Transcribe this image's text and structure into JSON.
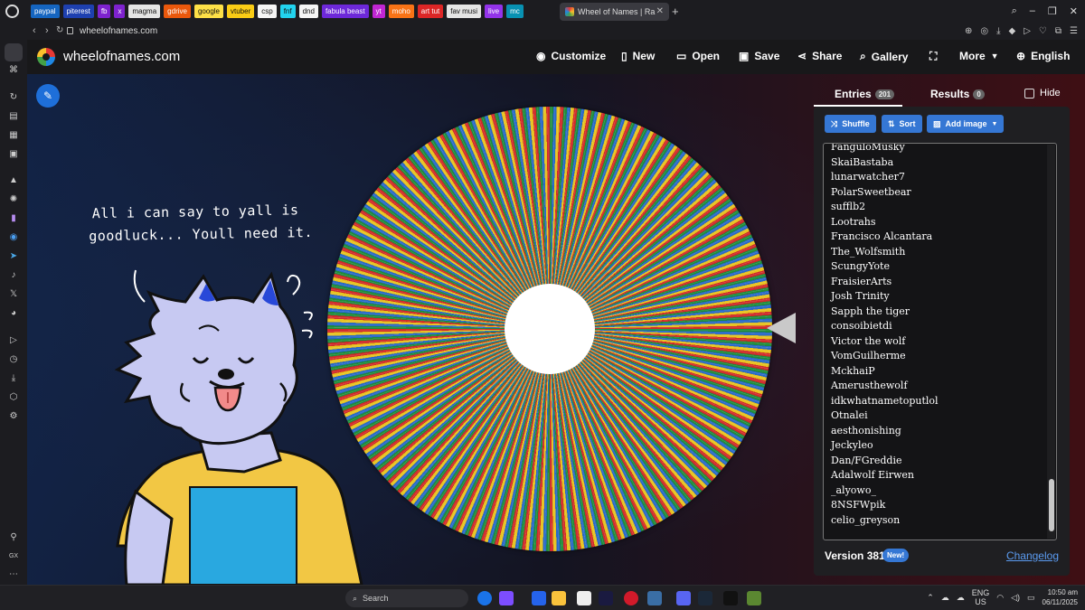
{
  "browser": {
    "bookmarks": [
      {
        "label": "paypal",
        "color": "#1565c0"
      },
      {
        "label": "piterest",
        "color": "#1e40af"
      },
      {
        "label": "fb",
        "color": "#7e22ce"
      },
      {
        "label": "x",
        "color": "#7e22ce"
      },
      {
        "label": "magma",
        "color": "#e5e5e5"
      },
      {
        "label": "gdrive",
        "color": "#ea580c"
      },
      {
        "label": "google",
        "color": "#fde047"
      },
      {
        "label": "vtuber",
        "color": "#facc15"
      },
      {
        "label": "csp",
        "color": "#f5f5f5"
      },
      {
        "label": "fnf",
        "color": "#22d3ee"
      },
      {
        "label": "dnd",
        "color": "#f5f5f5"
      },
      {
        "label": "fabula beast",
        "color": "#6d28d9"
      },
      {
        "label": "yt",
        "color": "#c026d3"
      },
      {
        "label": "moho",
        "color": "#f97316"
      },
      {
        "label": "art tut",
        "color": "#dc2626"
      },
      {
        "label": "fav musi",
        "color": "#e5e5e5"
      },
      {
        "label": "live",
        "color": "#9333ea"
      },
      {
        "label": "mc",
        "color": "#0891b2"
      }
    ],
    "active_tab_title": "Wheel of Names | Ra",
    "url": "wheelofnames.com"
  },
  "site": {
    "name": "wheelofnames.com",
    "menu": {
      "customize": "Customize",
      "new": "New",
      "open": "Open",
      "save": "Save",
      "share": "Share",
      "gallery": "Gallery",
      "more": "More",
      "language": "English"
    }
  },
  "panel": {
    "entries_tab": "Entries",
    "entries_count": "201",
    "results_tab": "Results",
    "results_count": "0",
    "hide_label": "Hide",
    "shuffle": "Shuffle",
    "sort": "Sort",
    "add_image": "Add image",
    "entries": [
      "FanguloMusky",
      "SkaiBastaba",
      "lunarwatcher7",
      "PolarSweetbear",
      "sufflb2",
      "Lootrahs",
      "Francisco Alcantara",
      "The_Wolfsmith",
      "ScungyYote",
      "FraisierArts",
      "Josh Trinity",
      "Sapph the tiger",
      "consoibietdi",
      "Victor the wolf",
      "VomGuilherme",
      "MckhaiP",
      "Amerusthewolf",
      "idkwhatnametoputlol",
      "Otnalei",
      "aesthonishing",
      "Jeckyleo",
      "Dan/FGreddie",
      "Adalwolf Eirwen",
      "_alyowo_",
      "8NSFWpik",
      "celio_greyson"
    ],
    "version": "Version 381",
    "new_badge": "New!",
    "changelog": "Changelog"
  },
  "overlay": {
    "speech_line1": "All i can say to yall is",
    "speech_line2": "goodluck... Youll need it.",
    "shirt_color": "#f2c744",
    "patch_color": "#29a8e0",
    "fur_color": "#c7c9f2"
  },
  "taskbar": {
    "search": "Search",
    "lang": "ENG",
    "region": "US",
    "time": "10:50 am",
    "date": "06/11/2025"
  }
}
